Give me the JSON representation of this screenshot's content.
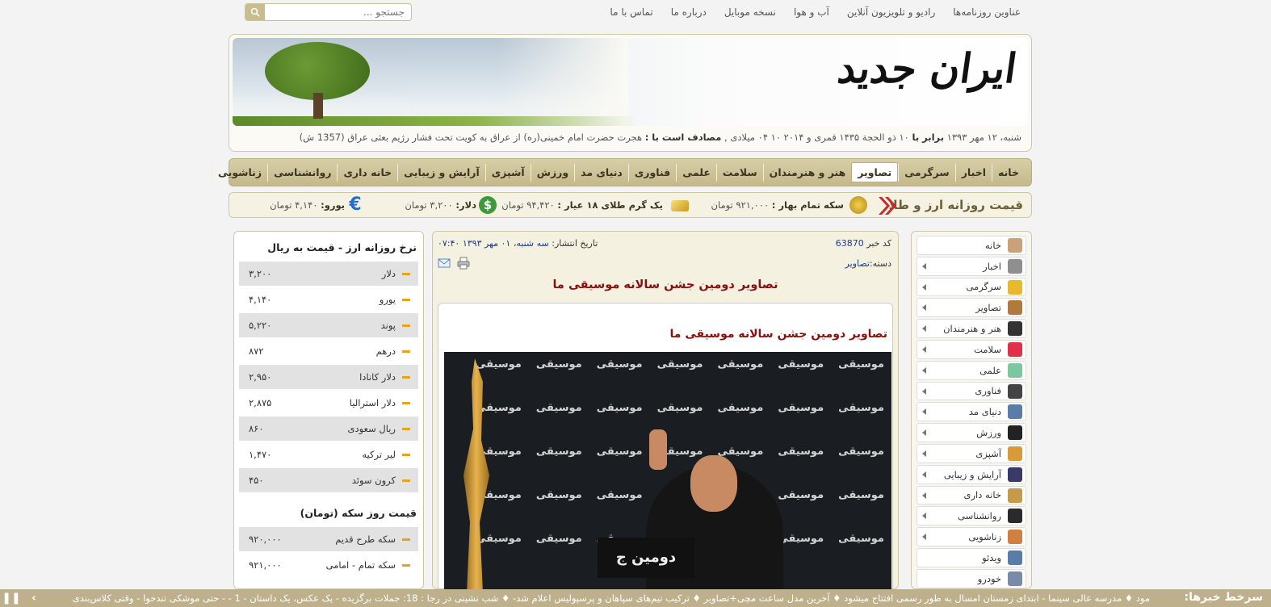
{
  "topnav": {
    "links": [
      "عناوین روزنامه‌ها",
      "رادیو و تلویزیون آنلاین",
      "آب و هوا",
      "نسخه موبایل",
      "درباره ما",
      "تماس با ما"
    ],
    "search_placeholder": "جستجو ..."
  },
  "header": {
    "logo": "ایران جدید",
    "date_text": "شنبه، ۱۲ مهر ۱۳۹۳ ",
    "date_bold1": "برابر با",
    "date_text2": " ۱۰ ذو الحجة ۱۴۳۵ قمری و ۲۰۱۴ ۱۰ ۰۴ میلادی , ",
    "date_bold2": "مصادف است با :",
    "date_text3": " هجرت حضرت امام خمینی(ره) از عراق به کویت تحت فشار رژیم بعثی عراق (1357 ش)"
  },
  "mainmenu": [
    "خانه",
    "اخبار",
    "سرگرمی",
    "تصاویر",
    "هنر و هنرمندان",
    "سلامت",
    "علمی",
    "فناوری",
    "دنیای مد",
    "ورزش",
    "آشپزی",
    "آرایش و زیبایی",
    "خانه داری",
    "روانشناسی",
    "زناشویی"
  ],
  "mainmenu_active": "تصاویر",
  "strip": {
    "title": "قیمت روزانه ارز و طلا",
    "coin_label": "سکه تمام بهار :",
    "coin_value": "۹۲۱,۰۰۰ تومان",
    "gold_label": "یک گرم طلای ۱۸ عیار :",
    "gold_value": "۹۴,۴۲۰ تومان",
    "dollar_label": "دلار:",
    "dollar_value": "۳,۲۰۰ تومان",
    "euro_label": "یورو:",
    "euro_value": "۴,۱۴۰ تومان"
  },
  "rside": {
    "items": [
      {
        "label": "خانه",
        "color": "#c9a27a"
      },
      {
        "label": "اخبار",
        "color": "#8f8f8f"
      },
      {
        "label": "سرگرمی",
        "color": "#e8b92c"
      },
      {
        "label": "تصاویر",
        "color": "#b07a3a"
      },
      {
        "label": "هنر و هنرمندان",
        "color": "#333333"
      },
      {
        "label": "سلامت",
        "color": "#e0304a"
      },
      {
        "label": "علمی",
        "color": "#7ac7a0"
      },
      {
        "label": "فناوری",
        "color": "#444444"
      },
      {
        "label": "دنیای مد",
        "color": "#5a7ca8"
      },
      {
        "label": "ورزش",
        "color": "#222222"
      },
      {
        "label": "آشپزی",
        "color": "#d89a3a"
      },
      {
        "label": "آرایش و زیبایی",
        "color": "#3a3a6a"
      },
      {
        "label": "خانه داری",
        "color": "#c79a4a"
      },
      {
        "label": "روانشناسی",
        "color": "#2a2a2a"
      },
      {
        "label": "زناشویی",
        "color": "#d08040"
      },
      {
        "label": "ویدئو",
        "color": "#5a7ca8"
      },
      {
        "label": "خودرو",
        "color": "#7a8aa8"
      }
    ]
  },
  "article": {
    "id_label": "کد خبر",
    "id": "63870",
    "pub_label": "تاریخ انتشار:",
    "pub_date": "سه شنبه، ۰۱ مهر ۱۳۹۳ ۰۷:۴۰",
    "cat_label": "دسته:",
    "category": "تصاویر",
    "title": "تصاویر دومین جشن سالانه موسیقی ما",
    "subtitle": "تصاویر دومین جشن سالانه موسیقی ما",
    "backdrop_word": "موسیقی",
    "backdrop_bottom": "دومین ج"
  },
  "rates": {
    "title": "نرخ روزانه ارز - قیمت به ریال",
    "rows": [
      {
        "name": "دلار",
        "value": "۳,۲۰۰"
      },
      {
        "name": "یورو",
        "value": "۴,۱۴۰"
      },
      {
        "name": "پوند",
        "value": "۵,۲۲۰"
      },
      {
        "name": "درهم",
        "value": "۸۷۲"
      },
      {
        "name": "دلار کانادا",
        "value": "۲,۹۵۰"
      },
      {
        "name": "دلار استرالیا",
        "value": "۲,۸۷۵"
      },
      {
        "name": "ریال سعودی",
        "value": "۸۶۰"
      },
      {
        "name": "لیر ترکیه",
        "value": "۱,۴۷۰"
      },
      {
        "name": "کرون سوئد",
        "value": "۴۵۰"
      }
    ],
    "coin_title": "قیمت روز سکه (تومان)",
    "coin_rows": [
      {
        "name": "سکه طرح قدیم",
        "value": "۹۲۰,۰۰۰"
      },
      {
        "name": "سکه تمام - امامی",
        "value": "۹۲۱,۰۰۰"
      }
    ]
  },
  "ticker": {
    "brand": "سرخط خبرها:",
    "text": "مود  ♦ مدرسه عالی سینما - ابتدای زمستان امسال به طور رسمی افتتاح میشود  ♦ آخرین مدل ساعت مچی+تصاویر  ♦ ترکیب تیم‌های سپاهان و پرسپولیس اعلام شد-  ♦ شب نشینی در رجا : 18: جملات برگزیده - یک عکس، یک داستان - 1 - - حتی موشکی تندخوا - وقتی کلاس‌بندی"
  }
}
